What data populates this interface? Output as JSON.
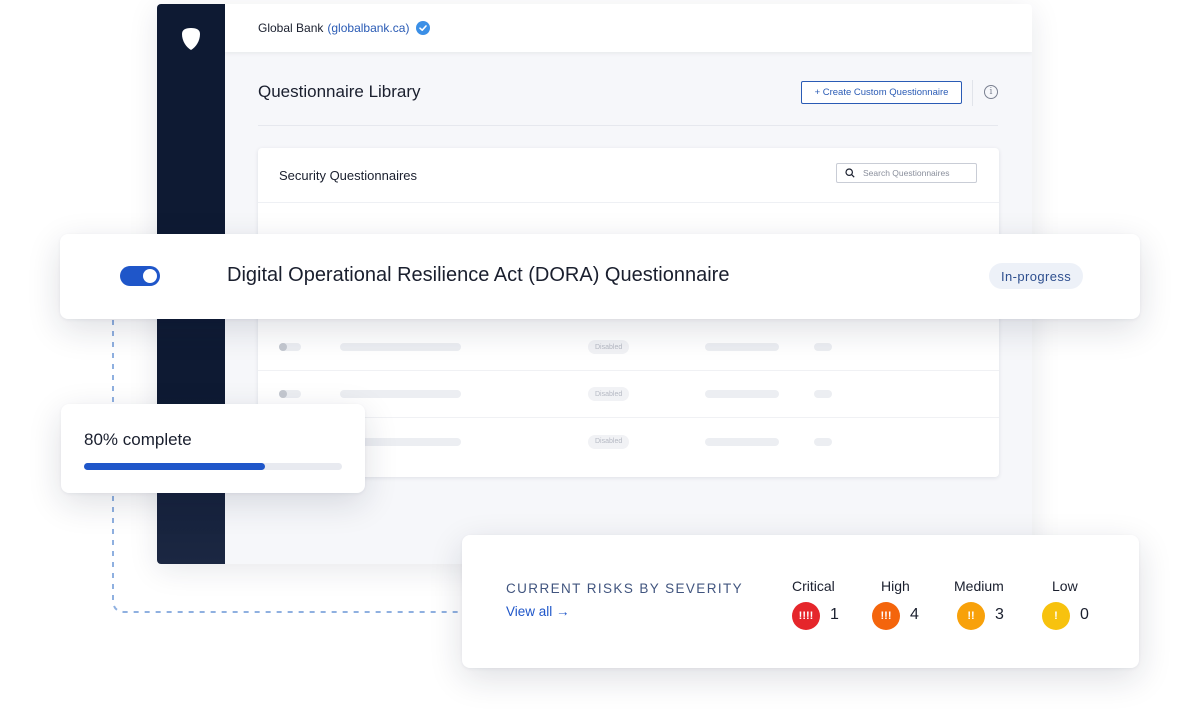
{
  "header": {
    "org_name": "Global Bank",
    "org_domain_open": "(",
    "org_domain": "globalbank.ca",
    "org_domain_close": ")"
  },
  "library": {
    "title": "Questionnaire Library",
    "create_button": "+ Create Custom Questionnaire",
    "info_glyph": "i"
  },
  "security_card": {
    "title": "Security Questionnaires",
    "search_placeholder": "Search Questionnaires",
    "row_status": "Disabled"
  },
  "dora": {
    "title": "Digital Operational Resilience Act (DORA) Questionnaire",
    "status": "In-progress",
    "enabled": true
  },
  "progress": {
    "label": "80% complete",
    "percent": 70
  },
  "risks": {
    "title": "CURRENT RISKS BY SEVERITY",
    "view_all": "View all →",
    "levels": [
      {
        "label": "Critical",
        "glyph": "!!!!",
        "count": "1",
        "color": "#e5262b"
      },
      {
        "label": "High",
        "glyph": "!!!",
        "count": "4",
        "color": "#f4650c"
      },
      {
        "label": "Medium",
        "glyph": "!!",
        "count": "3",
        "color": "#f8a10a"
      },
      {
        "label": "Low",
        "glyph": "!",
        "count": "0",
        "color": "#f7c20e"
      }
    ]
  },
  "colors": {
    "sidebar": "#0e1a33",
    "accent": "#1f56c9",
    "connector": "#8fb0e0"
  }
}
